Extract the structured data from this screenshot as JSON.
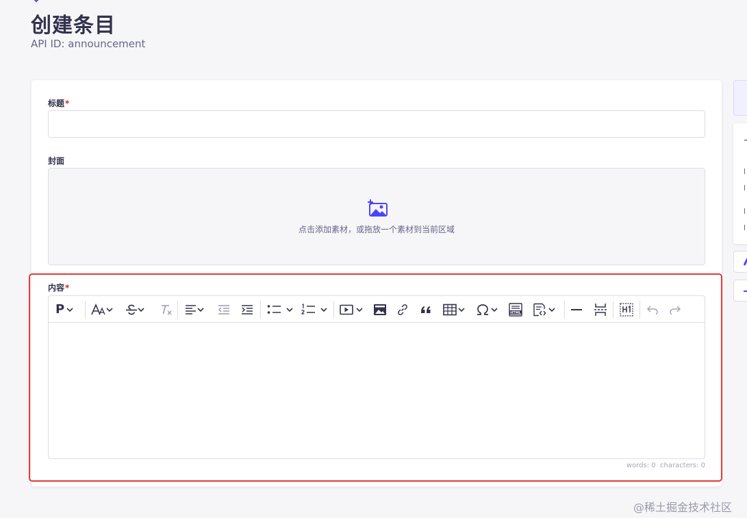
{
  "header": {
    "title": "创建条目",
    "api_id": "API ID: announcement"
  },
  "form": {
    "title_field": {
      "label": "标题",
      "required_mark": "*",
      "value": ""
    },
    "cover_field": {
      "label": "封面",
      "hint": "点击添加素材，或拖放一个素材到当前区域"
    },
    "content_field": {
      "label": "内容",
      "required_mark": "*",
      "value": ""
    }
  },
  "editor": {
    "toolbar": {
      "paragraph_format": "P",
      "font_size": "A",
      "source_label": "HTML"
    },
    "status": {
      "words": "words: 0",
      "characters": "characters: 0"
    }
  },
  "colors": {
    "accent": "#4945ff",
    "highlight_border": "#e53935",
    "required": "#d02b20"
  },
  "watermark": "@稀土掘金技术社区"
}
